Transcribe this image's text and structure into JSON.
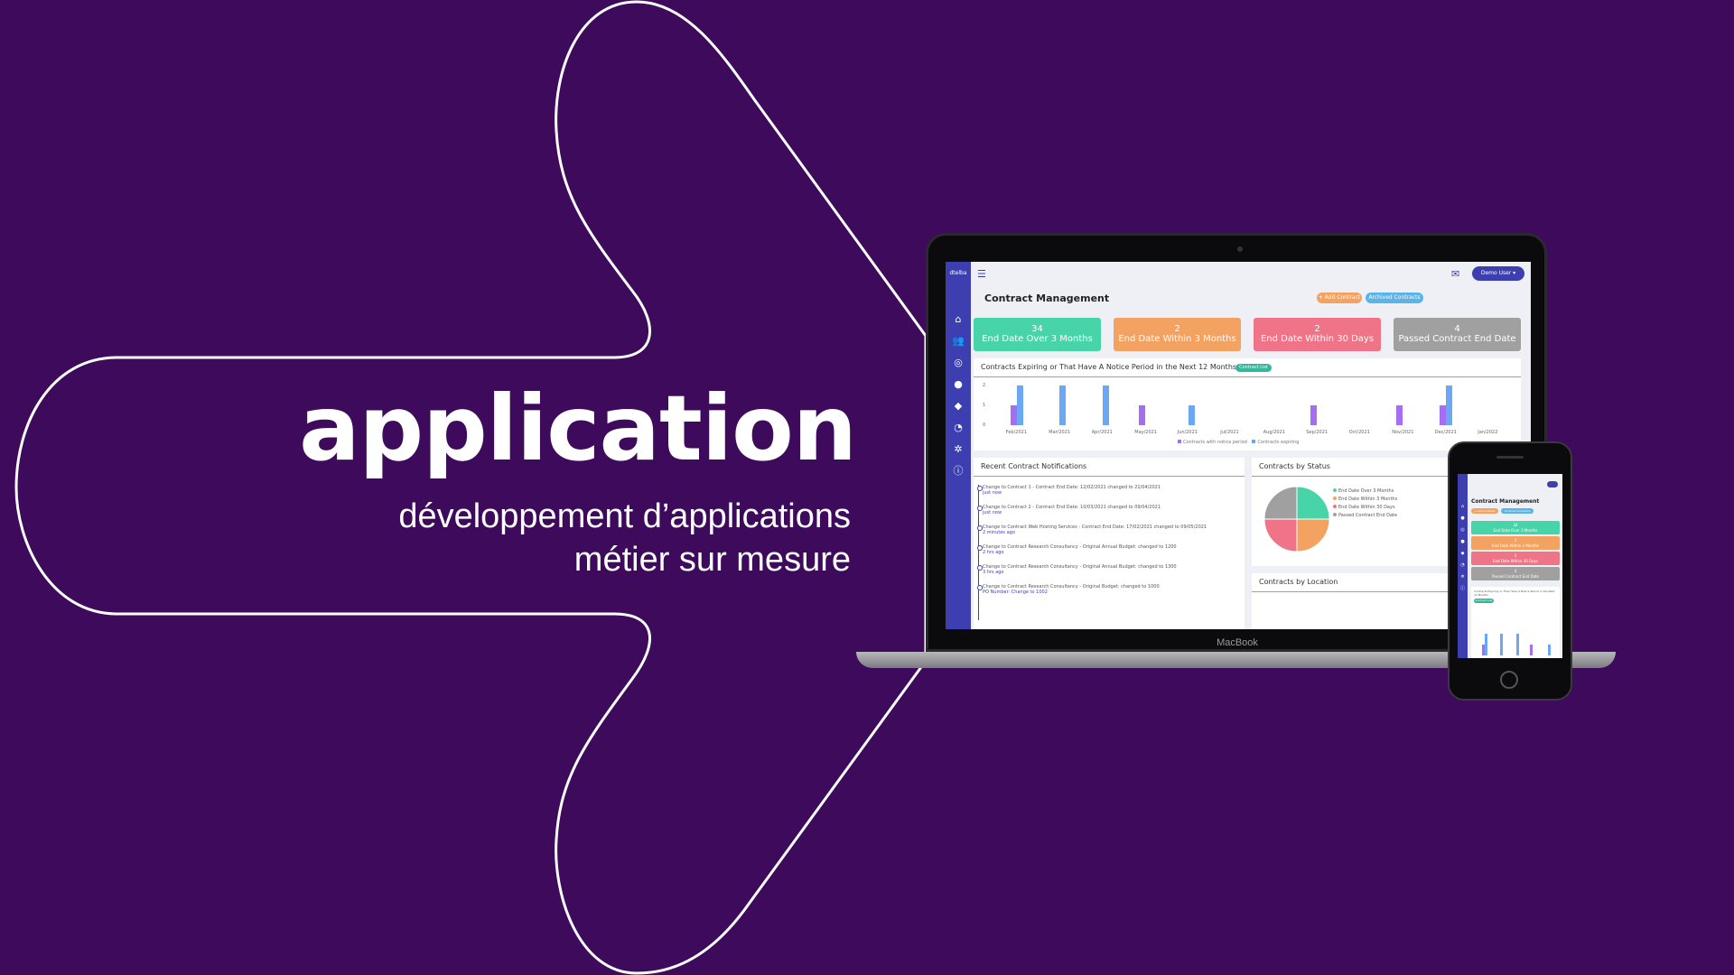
{
  "hero": {
    "title": "application",
    "subtitle_line1": "développement d’applications",
    "subtitle_line2": "métier sur mesure"
  },
  "colors": {
    "background": "#3d0a5c",
    "accent": "#3d3fb0",
    "green": "#47d4a8",
    "orange": "#f4a261",
    "pink": "#f07487",
    "gray": "#a0a0a0",
    "bar_purple": "#a56ef0",
    "bar_blue": "#6aa8f5"
  },
  "laptop": {
    "brand": "MacBook",
    "app": {
      "logo": "dtelba",
      "user_label": "Demo User",
      "page_title": "Contract Management",
      "add_button": "+ Add Contract",
      "archived_button": "Archived Contracts",
      "sidebar_icons": [
        "home-icon",
        "users-icon",
        "handshake-icon",
        "user-icon",
        "tags-icon",
        "chart-pie-icon",
        "cogs-icon",
        "info-icon"
      ],
      "cards": [
        {
          "count": "34",
          "label": "End Date Over 3 Months"
        },
        {
          "count": "2",
          "label": "End Date Within 3 Months"
        },
        {
          "count": "2",
          "label": "End Date Within 30 Days"
        },
        {
          "count": "4",
          "label": "Passed Contract End Date"
        }
      ],
      "expiring_panel": {
        "title": "Contracts Expiring or That Have A Notice Period in the Next 12 Months",
        "tag": "Contract List"
      },
      "notifications_panel": {
        "title": "Recent Contract Notifications",
        "items": [
          {
            "text": "Change to Contract 1 - Contract End Date: 12/02/2021 changed to 21/04/2021",
            "time": "just now"
          },
          {
            "text": "Change to Contract 2 - Contract End Date: 10/03/2021 changed to 09/04/2021",
            "time": "just now"
          },
          {
            "text": "Change to Contract Web Hosting Services - Contract End Date: 17/02/2021 changed to 09/05/2021",
            "time": "2 minutes ago"
          },
          {
            "text": "Change to Contract Research Consultancy - Original Annual Budget: changed to 1200",
            "time": "2 hrs ago"
          },
          {
            "text": "Change to Contract Research Consultancy - Original Annual Budget: changed to 1300",
            "time": "3 hrs ago"
          },
          {
            "text": "Change to Contract Research Consultancy - Original Budget: changed to 1000",
            "time": "PO Number: Change to 1002"
          }
        ]
      },
      "status_panel": {
        "title": "Contracts by Status",
        "legend": [
          "End Date Over 3 Months",
          "End Date Within 3 Months",
          "End Date Within 30 Days",
          "Passed Contract End Date"
        ]
      },
      "location_panel": {
        "title": "Contracts by Location"
      }
    }
  },
  "phone": {
    "page_title": "Contract Management",
    "add_button": "+ Add Contract",
    "archived_button": "Archived Contracts",
    "cards": [
      {
        "count": "34",
        "label": "End Date Over 3 Months"
      },
      {
        "count": "2",
        "label": "End Date Within 3 Months"
      },
      {
        "count": "2",
        "label": "End Date Within 30 Days"
      },
      {
        "count": "4",
        "label": "Passed Contract End Date"
      }
    ],
    "chart_title": "Contracts Expiring or That Have A Notice Period in the Next 12 Months",
    "tag": "Contract List"
  },
  "chart_data": [
    {
      "type": "bar",
      "title": "Contracts Expiring or That Have A Notice Period in the Next 12 Months",
      "categories": [
        "Feb/2021",
        "Mar/2021",
        "Apr/2021",
        "May/2021",
        "Jun/2021",
        "Jul/2021",
        "Aug/2021",
        "Sep/2021",
        "Oct/2021",
        "Nov/2021",
        "Dec/2021",
        "Jan/2022"
      ],
      "series": [
        {
          "name": "Contracts with notice period",
          "values": [
            1,
            0,
            0,
            1,
            0,
            0,
            0,
            1,
            0,
            1,
            1,
            0
          ]
        },
        {
          "name": "Contracts expiring",
          "values": [
            2,
            2,
            2,
            0,
            1,
            0,
            0,
            0,
            0,
            0,
            2,
            0
          ]
        }
      ],
      "yticks": [
        "0",
        "1",
        "2"
      ],
      "ylim": [
        0,
        2
      ]
    },
    {
      "type": "pie",
      "title": "Contracts by Status",
      "labels": [
        "End Date Over 3 Months",
        "End Date Within 3 Months",
        "End Date Within 30 Days",
        "Passed Contract End Date"
      ],
      "values": [
        1,
        1,
        1,
        1
      ]
    }
  ]
}
